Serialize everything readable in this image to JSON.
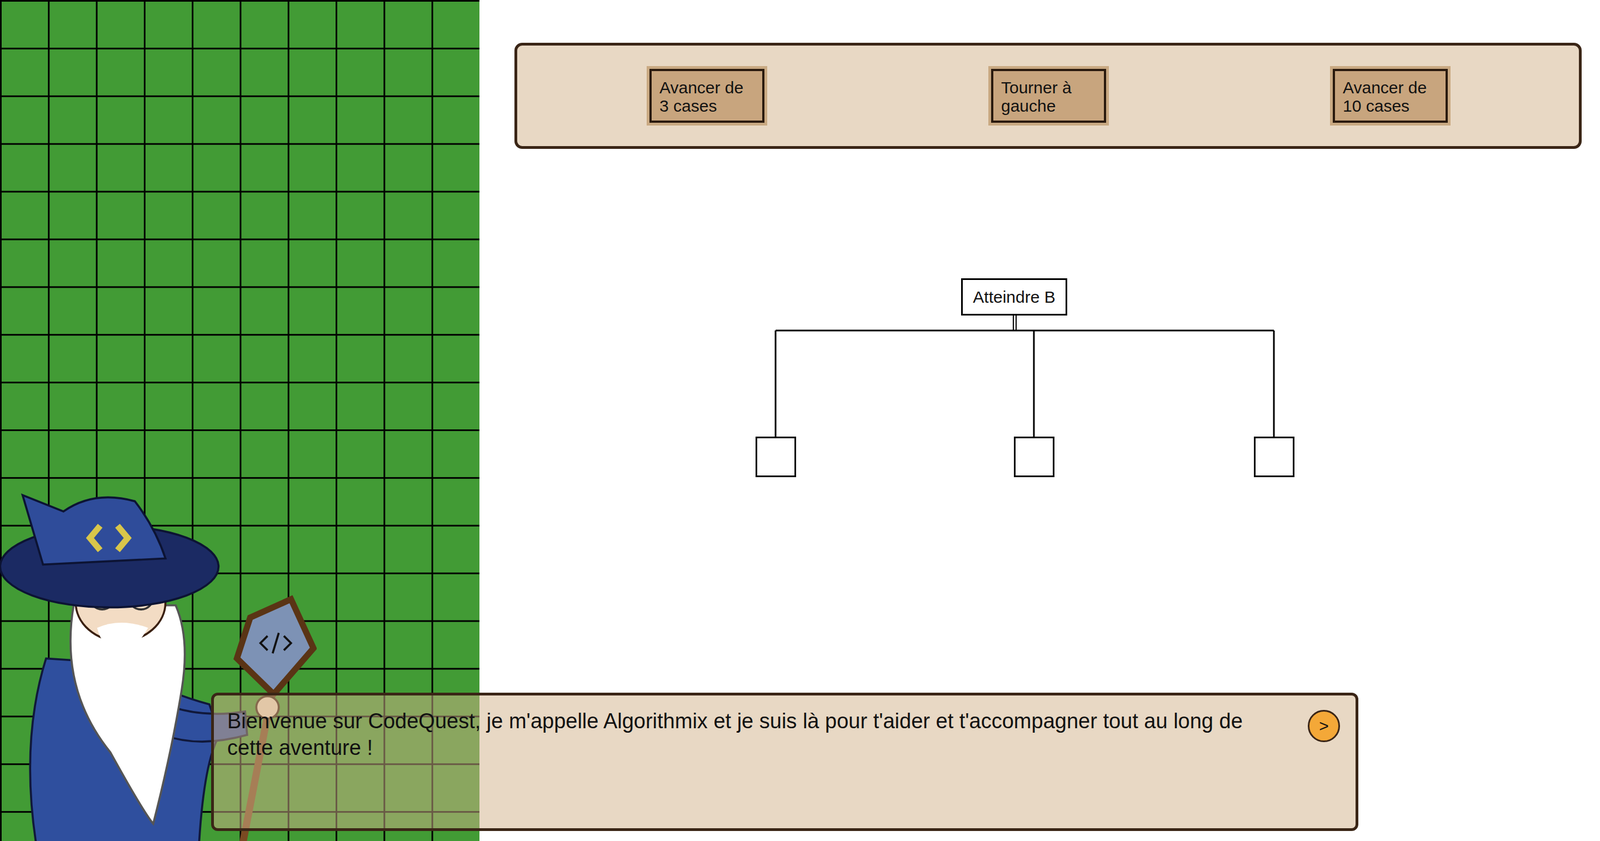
{
  "toolbar": {
    "blocks": [
      {
        "label": "Avancer de 3 cases"
      },
      {
        "label": "Tourner à gauche"
      },
      {
        "label": "Avancer de 10 cases"
      }
    ]
  },
  "tree": {
    "root": {
      "label": "Atteindre B"
    },
    "children": [
      {
        "label": ""
      },
      {
        "label": ""
      },
      {
        "label": ""
      }
    ]
  },
  "dialog": {
    "text": "Bienvenue sur CodeQuest, je m'appelle Algorithmix et je suis là pour t'aider et t'accompagner tout au long de cette aventure !",
    "next_button": ">"
  }
}
